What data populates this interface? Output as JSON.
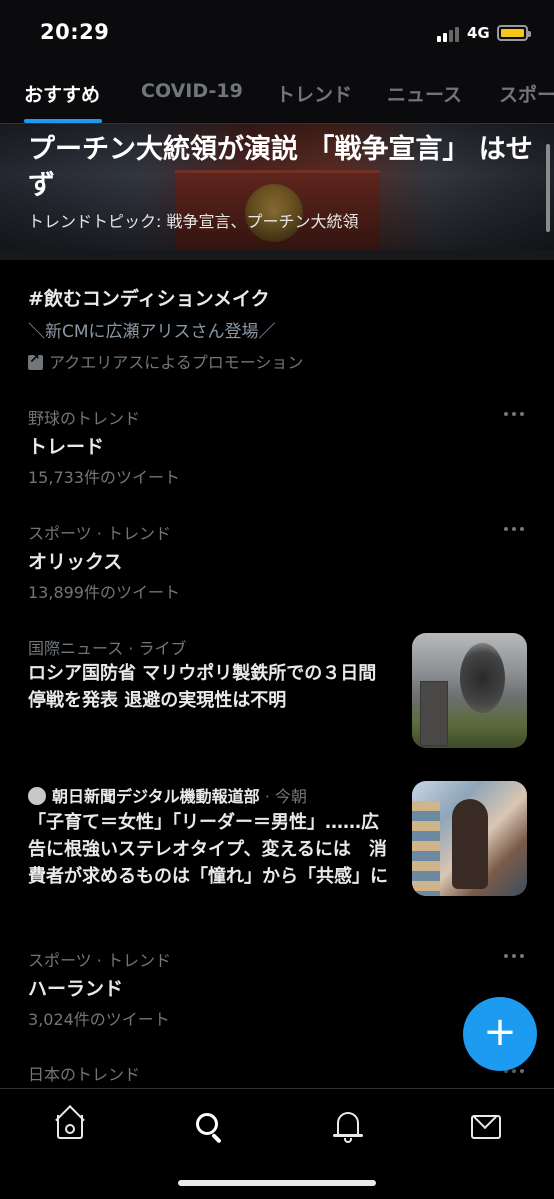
{
  "status_bar": {
    "time": "20:29",
    "network": "4G",
    "battery_level": 1.0,
    "battery_color": "#f5c518"
  },
  "tabs": [
    {
      "label": "おすすめ",
      "active": true
    },
    {
      "label": "COVID-19",
      "active": false
    },
    {
      "label": "トレンド",
      "active": false
    },
    {
      "label": "ニュース",
      "active": false
    },
    {
      "label": "スポー",
      "active": false
    }
  ],
  "hero": {
    "title": "プーチン大統領が演説 「戦争宣言」 はせず",
    "subtitle": "トレンドトピック: 戦争宣言、プーチン大統領"
  },
  "promo": {
    "title": "#飲むコンディションメイク",
    "subtitle": "＼新CMに広瀬アリスさん登場／",
    "promoted_by": "アクエリアスによるプロモーション",
    "icon": "promoted-arrow-icon"
  },
  "trends": [
    {
      "meta": "野球のトレンド",
      "title": "トレード",
      "count": "15,733件のツイート"
    },
    {
      "meta": "スポーツ · トレンド",
      "title": "オリックス",
      "count": "13,899件のツイート"
    },
    {
      "meta": "スポーツ · トレンド",
      "title": "ハーランド",
      "count": "3,024件のツイート"
    },
    {
      "meta": "日本のトレンド",
      "title": "",
      "count": ""
    }
  ],
  "news": [
    {
      "category": "国際ニュース",
      "separator": " · ",
      "status": "ライブ",
      "title": "ロシア国防省 マリウポリ製鉄所での３日間停戦を発表 退避の実現性は不明",
      "thumb_icon": "smoke-photo-icon"
    },
    {
      "source": "朝日新聞デジタル機動報道部",
      "time": " · 今朝",
      "title": "「子育て＝女性」「リーダー＝男性」……広告に根強いステレオタイプ、変えるには　消費者が求めるものは「憧れ」から「共感」に",
      "thumb_icon": "shopping-photo-icon"
    }
  ],
  "fab": {
    "label": "+",
    "icon": "compose-plus-icon"
  },
  "bottom_nav": [
    {
      "name": "home",
      "icon": "home-icon"
    },
    {
      "name": "explore",
      "icon": "search-icon"
    },
    {
      "name": "notifications",
      "icon": "bell-icon"
    },
    {
      "name": "messages",
      "icon": "mail-icon"
    }
  ],
  "colors": {
    "accent": "#1d9bf0",
    "background": "#000000",
    "secondary_text": "#71767b"
  }
}
